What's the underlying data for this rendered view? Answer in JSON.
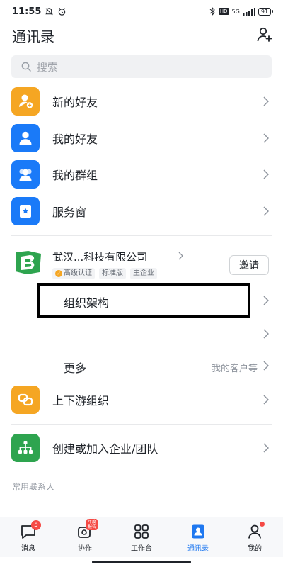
{
  "status_bar": {
    "time": "11:55",
    "network": "5G",
    "hd": "HD",
    "battery": "91"
  },
  "header": {
    "title": "通讯录"
  },
  "search": {
    "placeholder": "搜索"
  },
  "menu": {
    "new_friends": "新的好友",
    "my_friends": "我的好友",
    "my_groups": "我的群组",
    "service_window": "服务窗"
  },
  "organization": {
    "name": "武汉...科技有限公司",
    "badges": [
      "高级认证",
      "标准版",
      "主企业"
    ],
    "invite_label": "邀请",
    "structure_label": "组织架构",
    "more_label": "更多",
    "more_hint": "我的客户等"
  },
  "actions": {
    "upstream_downstream": "上下游组织",
    "create_join": "创建或加入企业/团队"
  },
  "section": {
    "frequent_contacts": "常用联系人"
  },
  "tabs": [
    {
      "label": "消息",
      "badge": "5"
    },
    {
      "label": "协作",
      "tag": "年度报告"
    },
    {
      "label": "工作台"
    },
    {
      "label": "通讯录"
    },
    {
      "label": "我的"
    }
  ],
  "colors": {
    "accent": "#1f78f0",
    "orange": "#f5a623",
    "green": "#2ea44f",
    "blue_icon": "#1a7af8",
    "badge_red": "#f54a45"
  }
}
